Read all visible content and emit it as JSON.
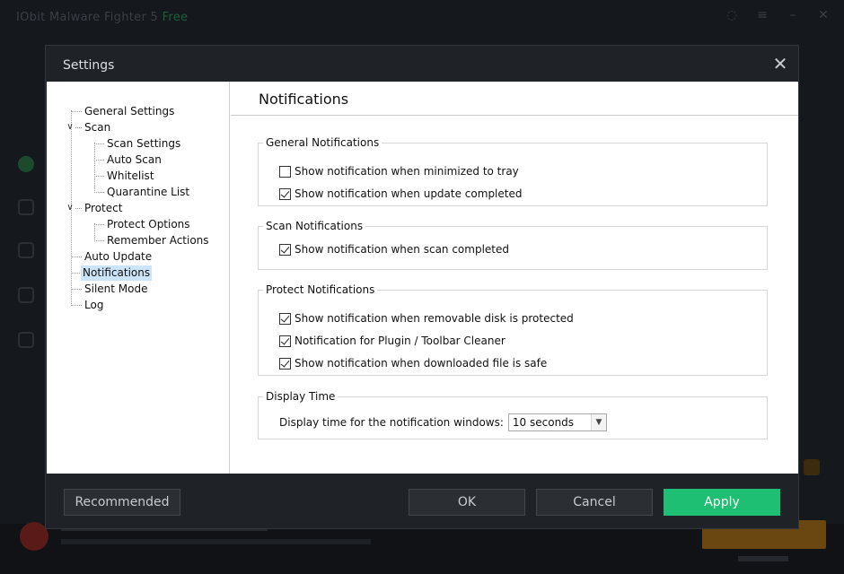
{
  "background_app": {
    "title": "IObit Malware Fighter 5",
    "edition": "Free"
  },
  "dialog": {
    "title": "Settings",
    "close_icon": "close-icon"
  },
  "tree": {
    "general_settings": "General Settings",
    "scan": "Scan",
    "scan_settings": "Scan Settings",
    "auto_scan": "Auto Scan",
    "whitelist": "Whitelist",
    "quarantine_list": "Quarantine List",
    "protect": "Protect",
    "protect_options": "Protect Options",
    "remember_actions": "Remember Actions",
    "auto_update": "Auto Update",
    "notifications": "Notifications",
    "silent_mode": "Silent Mode",
    "log": "Log",
    "selected": "Notifications"
  },
  "panel": {
    "title": "Notifications",
    "general": {
      "label": "General Notifications",
      "items": [
        {
          "label": "Show notification when minimized to tray",
          "checked": false
        },
        {
          "label": "Show notification when update completed",
          "checked": true
        }
      ]
    },
    "scan": {
      "label": "Scan Notifications",
      "items": [
        {
          "label": "Show notification when scan completed",
          "checked": true
        }
      ]
    },
    "protect": {
      "label": "Protect Notifications",
      "items": [
        {
          "label": "Show notification when removable disk is protected",
          "checked": true
        },
        {
          "label": "Notification for Plugin / Toolbar Cleaner",
          "checked": true
        },
        {
          "label": "Show notification when downloaded file is safe",
          "checked": true
        }
      ]
    },
    "display_time": {
      "label": "Display Time",
      "prompt": "Display time for the notification windows:",
      "value": "10 seconds"
    }
  },
  "footer": {
    "recommended": "Recommended",
    "ok": "OK",
    "cancel": "Cancel",
    "apply": "Apply"
  },
  "colors": {
    "apply": "#1fbf73",
    "selection": "#cce4f7",
    "dialog_bg": "#1f2226"
  }
}
